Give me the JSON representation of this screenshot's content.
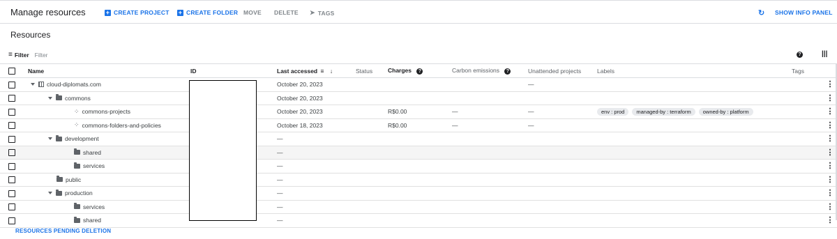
{
  "header": {
    "title": "Manage resources",
    "create_project": "CREATE PROJECT",
    "create_folder": "CREATE FOLDER",
    "move": "MOVE",
    "delete": "DELETE",
    "tags": "TAGS",
    "show_info_panel": "SHOW INFO PANEL"
  },
  "section_title": "Resources",
  "filter": {
    "label": "Filter",
    "placeholder": "Filter"
  },
  "columns": {
    "name": "Name",
    "id": "ID",
    "last_accessed": "Last accessed",
    "status": "Status",
    "charges": "Charges",
    "carbon": "Carbon emissions",
    "unattended": "Unattended projects",
    "labels": "Labels",
    "tags": "Tags"
  },
  "rows": [
    {
      "name": "cloud-diplomats.com",
      "type": "org",
      "indent": 0,
      "expand": true,
      "last": "October 20, 2023",
      "charges": "",
      "carbon": "",
      "unattended": "—",
      "labels": []
    },
    {
      "name": "commons",
      "type": "folder",
      "indent": 1,
      "expand": true,
      "last": "October 20, 2023",
      "charges": "",
      "carbon": "",
      "unattended": "",
      "labels": []
    },
    {
      "name": "commons-projects",
      "type": "project",
      "indent": 2,
      "expand": false,
      "last": "October 20, 2023",
      "charges": "R$0.00",
      "carbon": "—",
      "unattended": "—",
      "labels": [
        "env : prod",
        "managed-by : terraform",
        "owned-by : platform"
      ]
    },
    {
      "name": "commons-folders-and-policies",
      "type": "project",
      "indent": 2,
      "expand": false,
      "last": "October 18, 2023",
      "charges": "R$0.00",
      "carbon": "—",
      "unattended": "—",
      "labels": []
    },
    {
      "name": "development",
      "type": "folder",
      "indent": 1,
      "expand": true,
      "last": "—",
      "charges": "",
      "carbon": "",
      "unattended": "",
      "labels": []
    },
    {
      "name": "shared",
      "type": "folder",
      "indent": 2,
      "expand": false,
      "last": "—",
      "charges": "",
      "carbon": "",
      "unattended": "",
      "labels": []
    },
    {
      "name": "services",
      "type": "folder",
      "indent": 2,
      "expand": false,
      "last": "—",
      "charges": "",
      "carbon": "",
      "unattended": "",
      "labels": []
    },
    {
      "name": "public",
      "type": "folder",
      "indent": 1,
      "expand": false,
      "last": "—",
      "charges": "",
      "carbon": "",
      "unattended": "",
      "labels": []
    },
    {
      "name": "production",
      "type": "folder",
      "indent": 1,
      "expand": true,
      "last": "—",
      "charges": "",
      "carbon": "",
      "unattended": "",
      "labels": []
    },
    {
      "name": "services",
      "type": "folder",
      "indent": 2,
      "expand": false,
      "last": "—",
      "charges": "",
      "carbon": "",
      "unattended": "",
      "labels": []
    },
    {
      "name": "shared",
      "type": "folder",
      "indent": 2,
      "expand": false,
      "last": "—",
      "charges": "",
      "carbon": "",
      "unattended": "",
      "labels": []
    }
  ],
  "highlighted_row": 5,
  "pending_deletion": "RESOURCES PENDING DELETION",
  "colors": {
    "accent": "#1a73e8",
    "divider": "#dadce0"
  }
}
